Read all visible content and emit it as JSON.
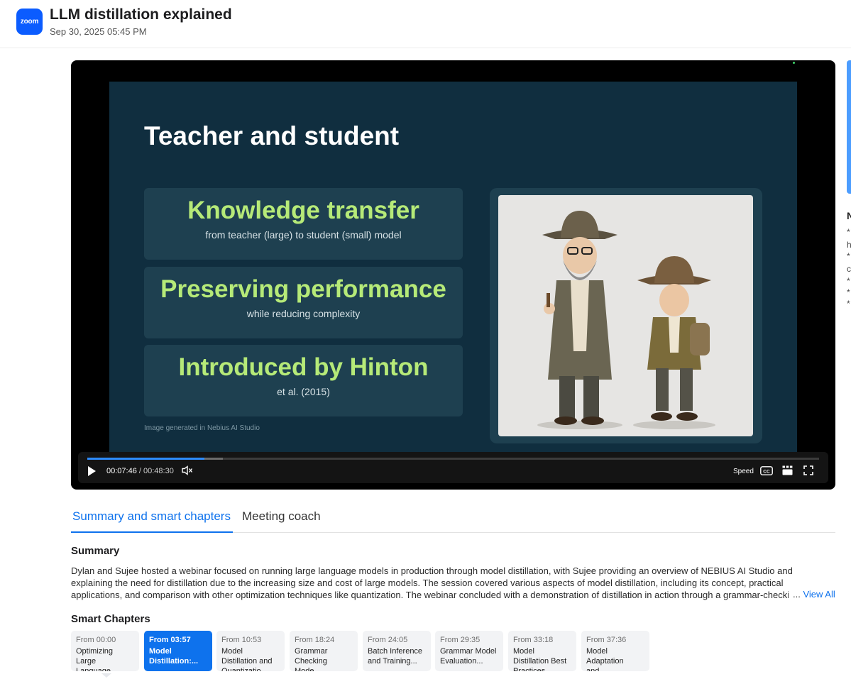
{
  "header": {
    "logo_text": "zoom",
    "title": "LLM distillation explained",
    "date": "Sep 30, 2025 05:45 PM"
  },
  "slide": {
    "title": "Teacher and student",
    "cards": [
      {
        "heading": "Knowledge transfer",
        "sub": "from teacher (large) to student (small) model"
      },
      {
        "heading": "Preserving performance",
        "sub": "while reducing complexity"
      },
      {
        "heading": "Introduced by Hinton",
        "sub": "et al. (2015)"
      }
    ],
    "credit": "Image generated in Nebius AI Studio"
  },
  "player": {
    "current_time": "00:07:46",
    "separator": "/",
    "total_time": "00:48:30",
    "played_fraction": 0.16,
    "buffered_fraction": 0.185,
    "speed_label": "Speed",
    "icons": [
      "play-icon",
      "volume-icon",
      "closed-captions-icon",
      "chapters-icon",
      "fullscreen-icon"
    ]
  },
  "side_panel": {
    "letter": "N",
    "lines": [
      "*",
      "h",
      "*",
      "c",
      "*",
      "*",
      "*"
    ]
  },
  "tabs": [
    {
      "label": "Summary and smart chapters",
      "active": true
    },
    {
      "label": "Meeting coach",
      "active": false
    }
  ],
  "summary": {
    "heading": "Summary",
    "text": "Dylan and Sujee hosted a webinar focused on running large language models in production through model distillation, with Sujee providing an overview of NEBIUS AI Studio and explaining the need for distillation due to the increasing size and cost of large models. The session covered various aspects of model distillation, including its concept, practical applications, and comparison with other optimization techniques like quantization. The webinar concluded with a demonstration of distillation in action through a grammar-checking example, followed by a discussion of model",
    "ellipsis": "...",
    "view_all": "View All"
  },
  "smart_chapters": {
    "heading": "Smart Chapters",
    "items": [
      {
        "from": "From 00:00",
        "title": "Optimizing Large Language...",
        "active": false
      },
      {
        "from": "From 03:57",
        "title": "Model Distillation:...",
        "active": true
      },
      {
        "from": "From 10:53",
        "title": "Model Distillation and Quantizatio...",
        "active": false
      },
      {
        "from": "From 18:24",
        "title": "Grammar Checking Mode...",
        "active": false
      },
      {
        "from": "From 24:05",
        "title": "Batch Inference and Training...",
        "active": false
      },
      {
        "from": "From 29:35",
        "title": "Grammar Model Evaluation...",
        "active": false
      },
      {
        "from": "From 33:18",
        "title": "Model Distillation Best Practices",
        "active": false
      },
      {
        "from": "From 37:36",
        "title": "Model Adaptation and...",
        "active": false
      }
    ]
  },
  "colors": {
    "accent": "#0e72ed",
    "brand": "#0b5cff",
    "slide_bg": "#102e3f",
    "slide_heading": "#b6ea78"
  }
}
